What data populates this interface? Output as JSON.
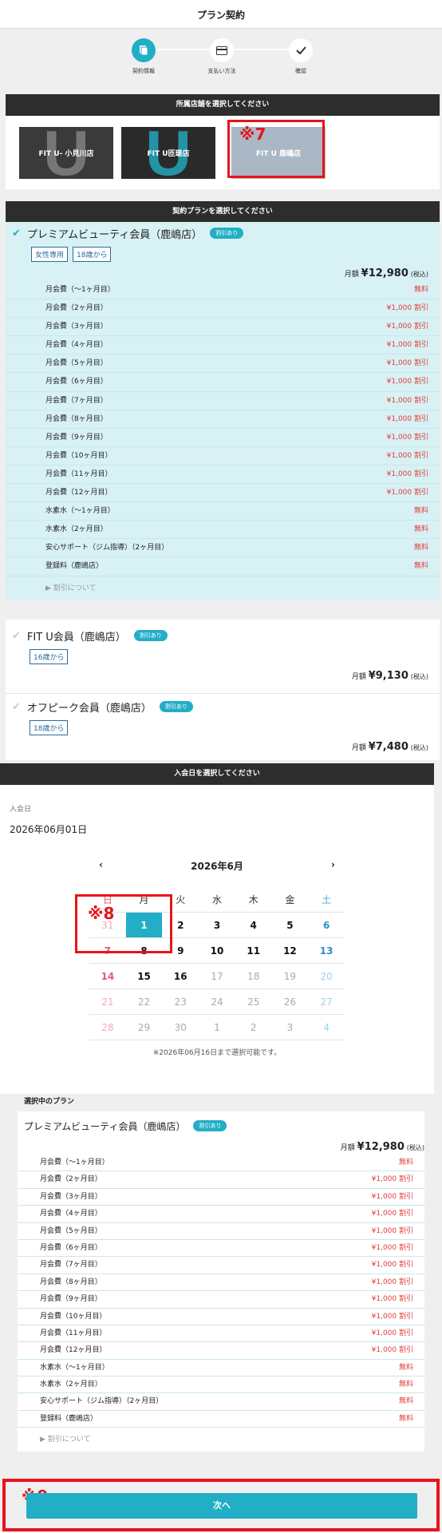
{
  "page_title": "プラン契約",
  "steps": [
    "契約情報",
    "支払い方法",
    "確認"
  ],
  "store_header": "所属店舗を選択してください",
  "stores": [
    "FIT U- 小見川店",
    "FIT U匝瑳店",
    "FIT U 鹿嶋店"
  ],
  "store_letter": "U",
  "plan_header": "契約プランを選択してください",
  "marks": {
    "m7": "※7",
    "m8": "※8",
    "m9": "※9"
  },
  "discount_badge": "割引あり",
  "plans": [
    {
      "name": "プレミアムビューティ会員（鹿嶋店）",
      "tags": [
        "女性専用",
        "18歳から"
      ],
      "price_prefix": "月額",
      "price": "¥12,980",
      "tax": "(税込)"
    },
    {
      "name": "FIT U会員（鹿嶋店）",
      "tags": [
        "16歳から"
      ],
      "price_prefix": "月額",
      "price": "¥9,130",
      "tax": "(税込)"
    },
    {
      "name": "オフピーク会員（鹿嶋店）",
      "tags": [
        "18歳から"
      ],
      "price_prefix": "月額",
      "price": "¥7,480",
      "tax": "(税込)"
    }
  ],
  "fee_rows": [
    {
      "label": "月会費（～1ヶ月目）",
      "value": "無料"
    },
    {
      "label": "月会費（2ヶ月目）",
      "value": "¥1,000 割引"
    },
    {
      "label": "月会費（3ヶ月目）",
      "value": "¥1,000 割引"
    },
    {
      "label": "月会費（4ヶ月目）",
      "value": "¥1,000 割引"
    },
    {
      "label": "月会費（5ヶ月目）",
      "value": "¥1,000 割引"
    },
    {
      "label": "月会費（6ヶ月目）",
      "value": "¥1,000 割引"
    },
    {
      "label": "月会費（7ヶ月目）",
      "value": "¥1,000 割引"
    },
    {
      "label": "月会費（8ヶ月目）",
      "value": "¥1,000 割引"
    },
    {
      "label": "月会費（9ヶ月目）",
      "value": "¥1,000 割引"
    },
    {
      "label": "月会費（10ヶ月目）",
      "value": "¥1,000 割引"
    },
    {
      "label": "月会費（11ヶ月目）",
      "value": "¥1,000 割引"
    },
    {
      "label": "月会費（12ヶ月目）",
      "value": "¥1,000 割引"
    },
    {
      "label": "水素水（～1ヶ月目）",
      "value": "無料"
    },
    {
      "label": "水素水（2ヶ月目）",
      "value": "無料"
    },
    {
      "label": "安心サポート（ジム指導）（2ヶ月目）",
      "value": "無料"
    },
    {
      "label": "登録料（鹿嶋店）",
      "value": "無料"
    }
  ],
  "discount_note": "▶ 割引について",
  "date_header": "入会日を選択してください",
  "date_label": "入会日",
  "date_value": "2026年06月01日",
  "calendar": {
    "prev": "‹",
    "next": "›",
    "month": "2026年6月",
    "weekdays": [
      "日",
      "月",
      "火",
      "水",
      "木",
      "金",
      "土"
    ],
    "weeks": [
      [
        "31",
        "1",
        "2",
        "3",
        "4",
        "5",
        "6"
      ],
      [
        "7",
        "8",
        "9",
        "10",
        "11",
        "12",
        "13"
      ],
      [
        "14",
        "15",
        "16",
        "17",
        "18",
        "19",
        "20"
      ],
      [
        "21",
        "22",
        "23",
        "24",
        "25",
        "26",
        "27"
      ],
      [
        "28",
        "29",
        "30",
        "1",
        "2",
        "3",
        "4"
      ]
    ],
    "selected": "1",
    "note": "※2026年06月16日まで選択可能です。"
  },
  "selected_plan_label": "選択中のプラン",
  "next_button": "次へ",
  "colors": {
    "accent": "#22aec6",
    "red": "#e7141a",
    "dark": "#2d2d2d"
  }
}
